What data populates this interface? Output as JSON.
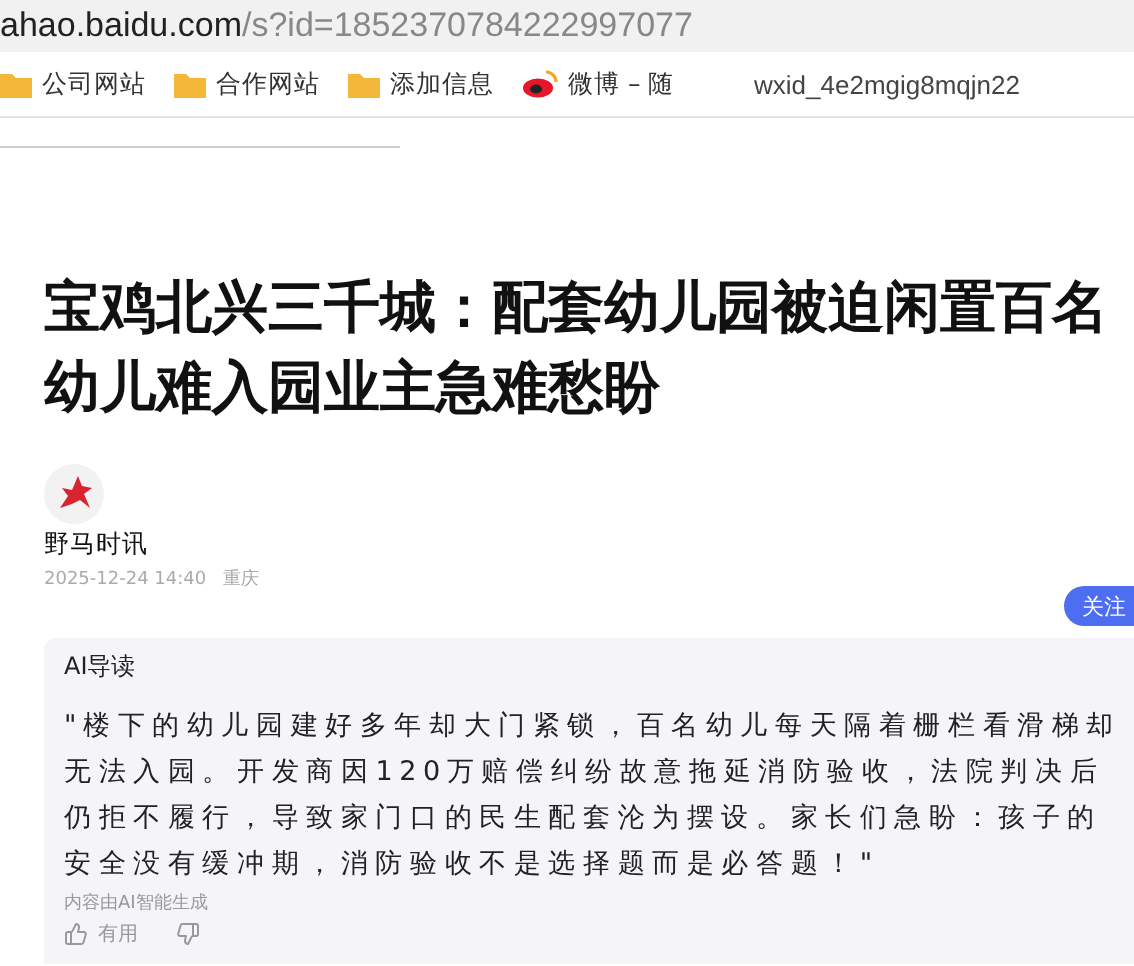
{
  "address_bar": {
    "host": "ahao.baidu.com",
    "path": "/s?id=1852370784222997077"
  },
  "bookmarks": [
    {
      "kind": "folder",
      "label": "公司网站"
    },
    {
      "kind": "folder",
      "label": "合作网站"
    },
    {
      "kind": "folder",
      "label": "添加信息"
    },
    {
      "kind": "weibo",
      "label": "微博 – 随"
    }
  ],
  "account": "wxid_4e2mgig8mqjn22",
  "article": {
    "title": "宝鸡北兴三千城：配套幼儿园被迫闲置百名幼儿难入园业主急难愁盼",
    "author": "野马时讯",
    "date": "2025-12-24 14:40",
    "location": "重庆",
    "follow_button": "关注"
  },
  "ai_summary": {
    "heading": "AI导读",
    "text": "\"楼下的幼儿园建好多年却大门紧锁，百名幼儿每天隔着栅栏看滑梯却无法入园。开发商因120万赔偿纠纷故意拖延消防验收，法院判决后仍拒不履行，导致家门口的民生配套沦为摆设。家长们急盼：孩子的安全没有缓冲期，消防验收不是选择题而是必答题！\"",
    "note": "内容由AI智能生成",
    "useful": "有用"
  }
}
